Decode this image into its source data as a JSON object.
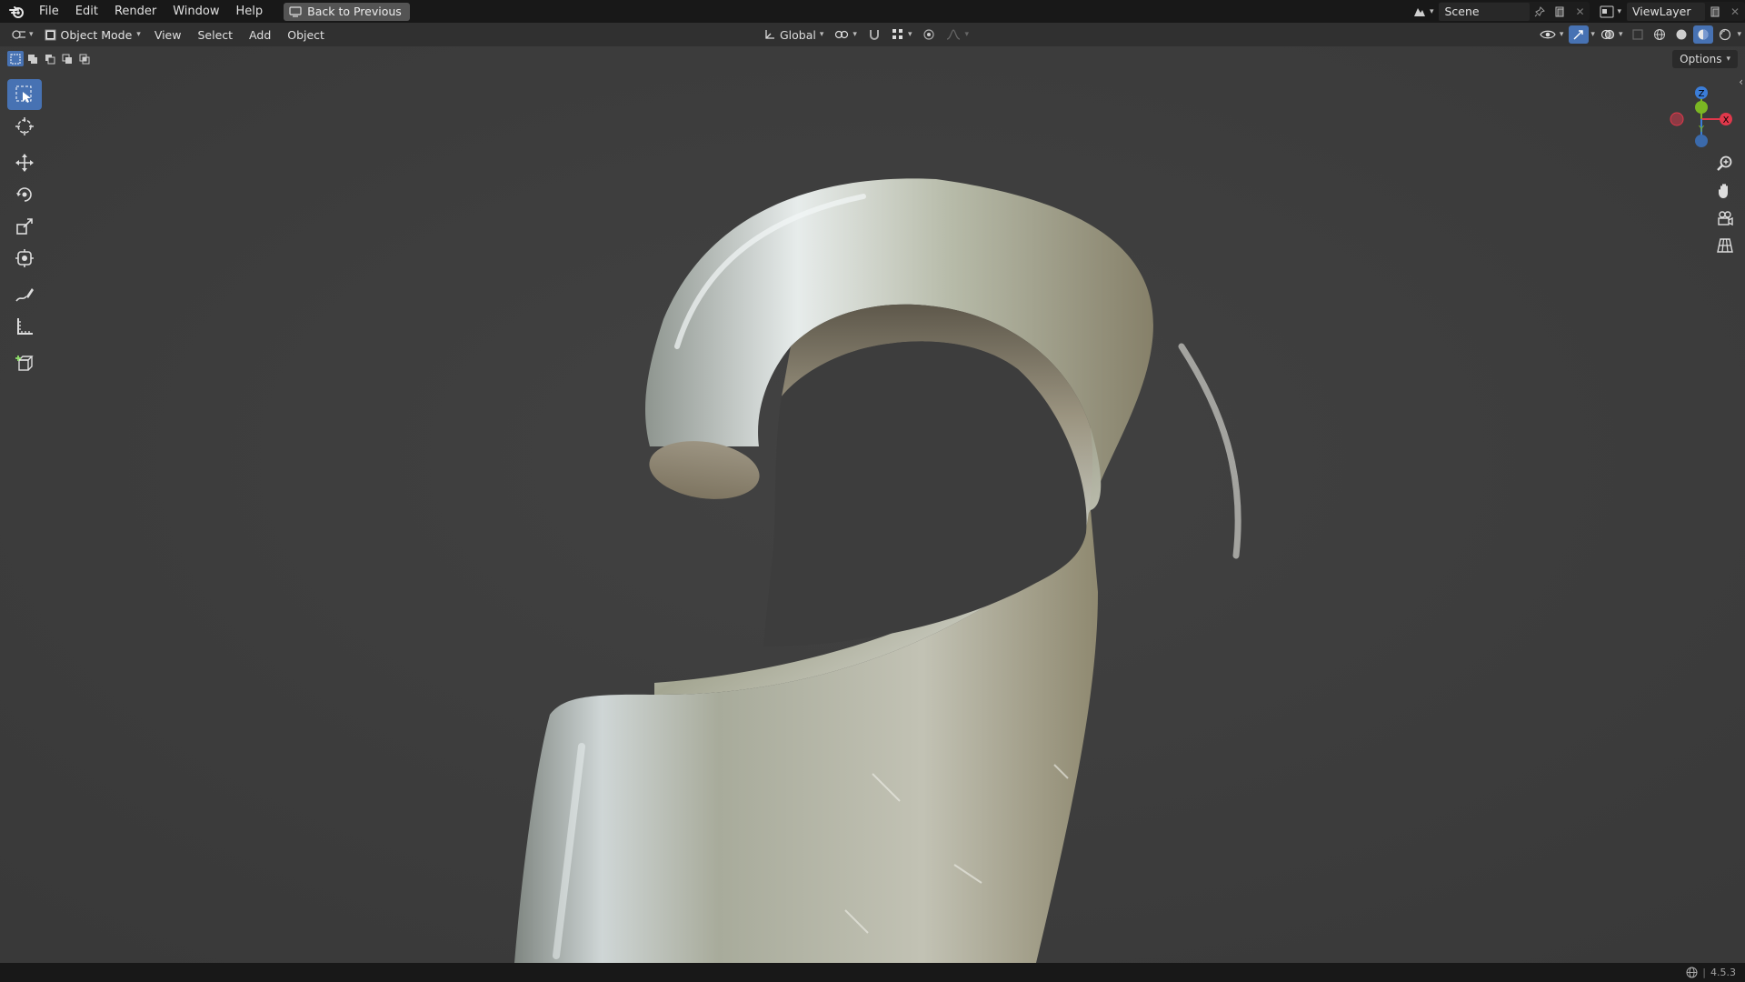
{
  "topbar": {
    "menu": [
      "File",
      "Edit",
      "Render",
      "Window",
      "Help"
    ],
    "back_label": "Back to Previous",
    "scene_name": "Scene",
    "view_layer": "ViewLayer"
  },
  "header": {
    "mode": "Object Mode",
    "menus": [
      "View",
      "Select",
      "Add",
      "Object"
    ],
    "orientation": "Global"
  },
  "viewport": {
    "options_label": "Options",
    "gizmo": {
      "z": "Z",
      "y": "Y",
      "x": "X"
    }
  },
  "tools": [
    "select-box-icon",
    "cursor-icon",
    "move-icon",
    "rotate-icon",
    "scale-icon",
    "transform-icon",
    "annotate-icon",
    "measure-icon",
    "add-cube-icon"
  ],
  "status": {
    "version": "4.5.3"
  },
  "colors": {
    "accent": "#4772b3",
    "axis_x": "#e0384b",
    "axis_y": "#7bb623",
    "axis_z": "#3b7dd8"
  }
}
